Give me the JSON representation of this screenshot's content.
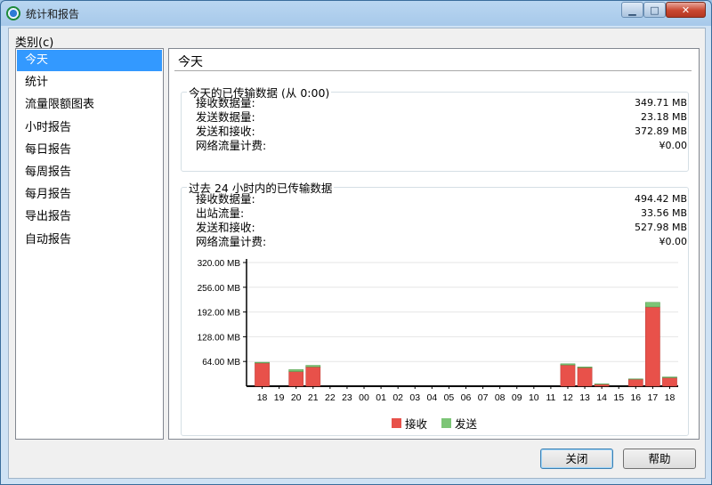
{
  "window": {
    "title": "统计和报告",
    "min": "▁",
    "max": "□",
    "close": "✕"
  },
  "category_label": "类别(c)",
  "sidebar": {
    "items": [
      {
        "label": "今天",
        "selected": true
      },
      {
        "label": "统计"
      },
      {
        "label": "流量限额图表"
      },
      {
        "label": "小时报告"
      },
      {
        "label": "每日报告"
      },
      {
        "label": "每周报告"
      },
      {
        "label": "每月报告"
      },
      {
        "label": "导出报告"
      },
      {
        "label": "自动报告"
      }
    ]
  },
  "panel": {
    "title": "今天",
    "today_group": {
      "title": "今天的已传输数据 (从 0:00)",
      "rows": [
        {
          "label": "接收数据量:",
          "value": "349.71 MB"
        },
        {
          "label": "发送数据量:",
          "value": "23.18 MB"
        },
        {
          "label": "发送和接收:",
          "value": "372.89 MB"
        },
        {
          "label": "网络流量计费:",
          "value": "¥0.00"
        }
      ]
    },
    "last24_group": {
      "title": "过去 24 小时内的已传输数据",
      "rows": [
        {
          "label": "接收数据量:",
          "value": "494.42 MB"
        },
        {
          "label": "出站流量:",
          "value": "33.56 MB"
        },
        {
          "label": "发送和接收:",
          "value": "527.98 MB"
        },
        {
          "label": "网络流量计费:",
          "value": "¥0.00"
        }
      ]
    }
  },
  "chart_data": {
    "type": "bar",
    "stacked": true,
    "categories": [
      "18",
      "19",
      "20",
      "21",
      "22",
      "23",
      "00",
      "01",
      "02",
      "03",
      "04",
      "05",
      "06",
      "07",
      "08",
      "09",
      "10",
      "11",
      "12",
      "13",
      "14",
      "15",
      "16",
      "17",
      "18"
    ],
    "y_ticks": [
      "64.00 MB",
      "128.00 MB",
      "192.00 MB",
      "256.00 MB",
      "320.00 MB"
    ],
    "ylim": [
      0,
      320
    ],
    "series": [
      {
        "name": "接收",
        "color": "#e8514a",
        "values": [
          60,
          0,
          38,
          50,
          0,
          0,
          0,
          0,
          0,
          0,
          0,
          0,
          0,
          0,
          0,
          0,
          0,
          0,
          55,
          48,
          5,
          0,
          18,
          205,
          22
        ]
      },
      {
        "name": "发送",
        "color": "#7cc576",
        "values": [
          2,
          0,
          5,
          4,
          0,
          0,
          0,
          0,
          0,
          0,
          0,
          0,
          0,
          0,
          0,
          0,
          0,
          0,
          3,
          2,
          1,
          0,
          1,
          12,
          2
        ]
      }
    ],
    "grid": true,
    "legend": "bottom"
  },
  "buttons": {
    "close": "关闭",
    "help": "帮助"
  }
}
